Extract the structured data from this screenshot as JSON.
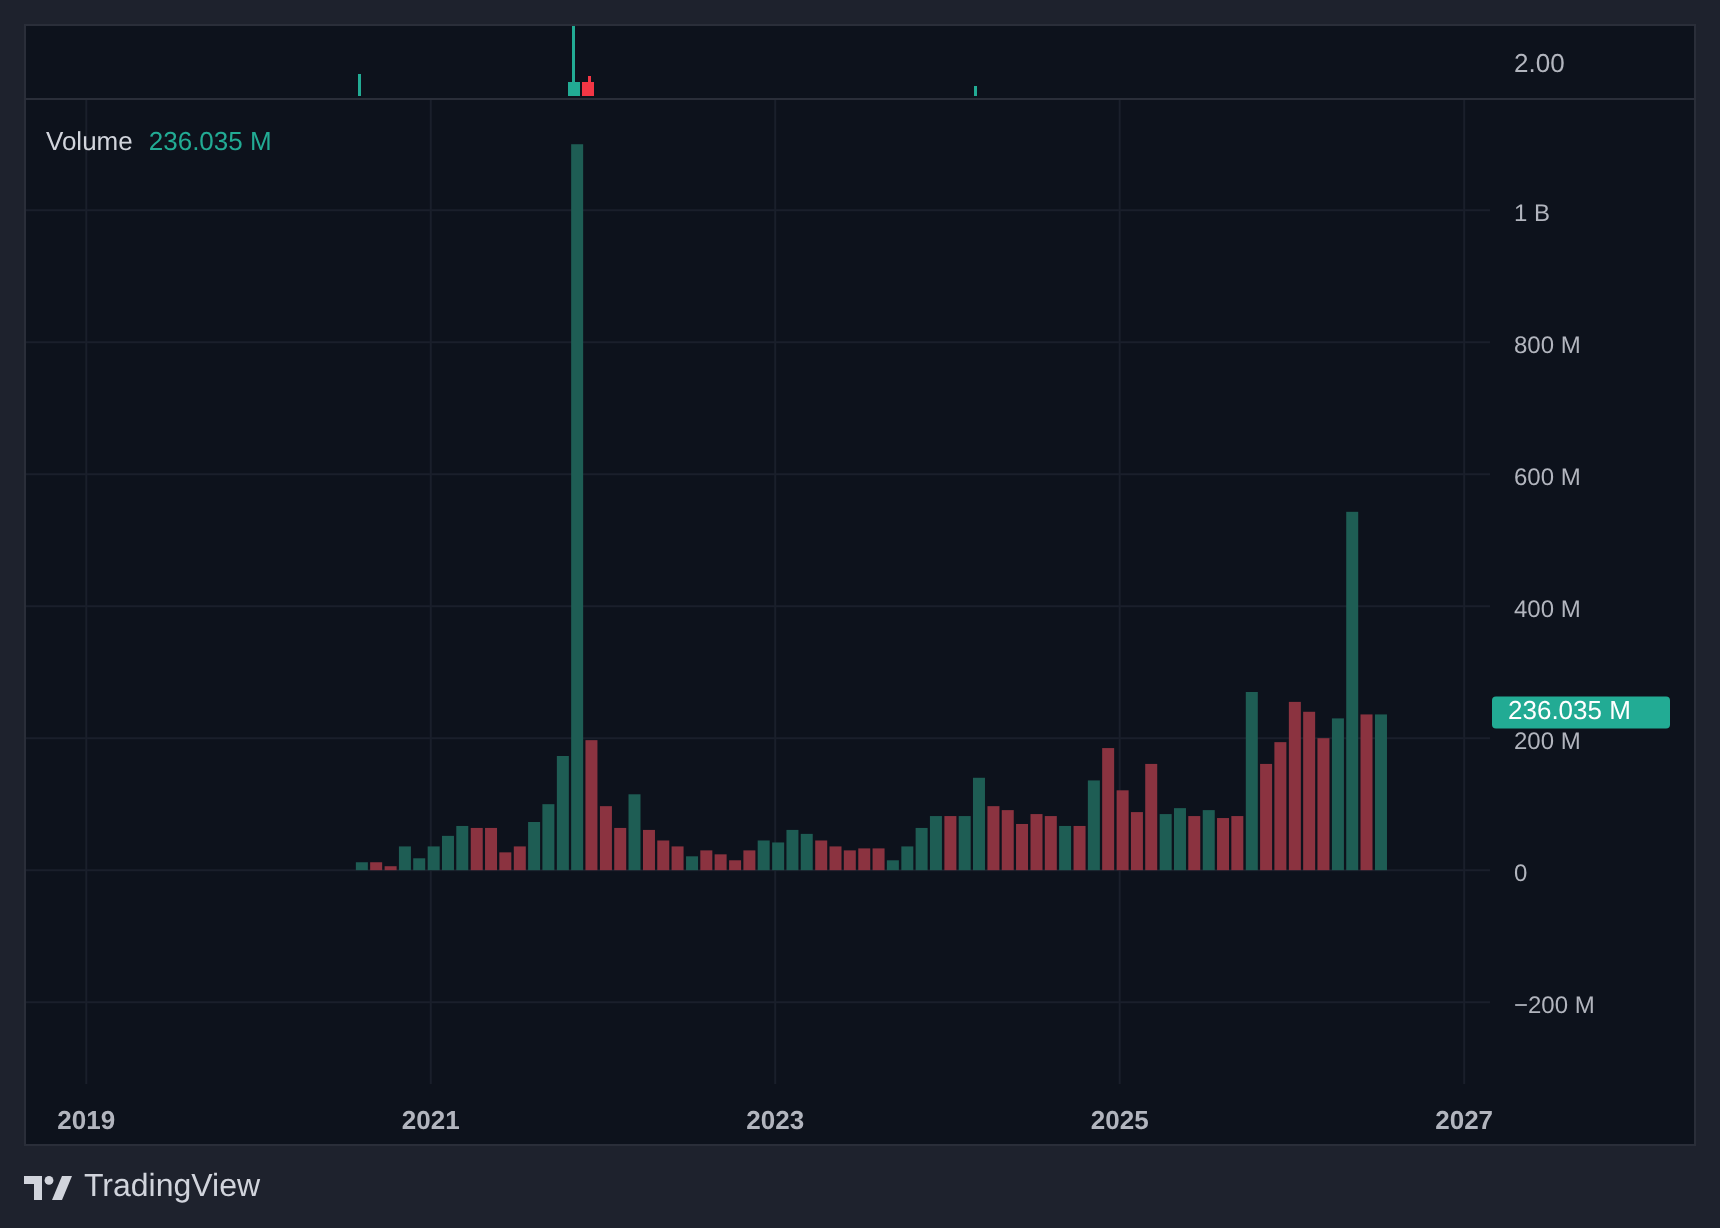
{
  "price_pane": {
    "scale_label": "2.00"
  },
  "legend": {
    "label": "Volume",
    "value": "236.035 M"
  },
  "last_value_badge": "236.035 M",
  "chart_data": {
    "type": "bar",
    "grid": true,
    "xlim": [
      2018.65,
      2027.15
    ],
    "ylim": [
      -324000000,
      1167000000
    ],
    "xticks": [
      {
        "value": 2019,
        "label": "2019"
      },
      {
        "value": 2021,
        "label": "2021"
      },
      {
        "value": 2023,
        "label": "2023"
      },
      {
        "value": 2025,
        "label": "2025"
      },
      {
        "value": 2027,
        "label": "2027"
      }
    ],
    "yticks": [
      {
        "value": -200000000,
        "label": "−200 M"
      },
      {
        "value": 0,
        "label": "0"
      },
      {
        "value": 200000000,
        "label": "200 M"
      },
      {
        "value": 400000000,
        "label": "400 M"
      },
      {
        "value": 600000000,
        "label": "600 M"
      },
      {
        "value": 800000000,
        "label": "800 M"
      },
      {
        "value": 1000000000,
        "label": "1 B"
      }
    ],
    "x": [
      2020.6,
      2020.683,
      2020.767,
      2020.85,
      2020.933,
      2021.017,
      2021.1,
      2021.183,
      2021.267,
      2021.35,
      2021.433,
      2021.517,
      2021.6,
      2021.683,
      2021.767,
      2021.85,
      2021.933,
      2022.017,
      2022.1,
      2022.183,
      2022.267,
      2022.35,
      2022.433,
      2022.517,
      2022.6,
      2022.683,
      2022.767,
      2022.85,
      2022.933,
      2023.017,
      2023.1,
      2023.183,
      2023.267,
      2023.35,
      2023.433,
      2023.517,
      2023.6,
      2023.683,
      2023.767,
      2023.85,
      2023.933,
      2024.017,
      2024.1,
      2024.183,
      2024.267,
      2024.35,
      2024.433,
      2024.517,
      2024.6,
      2024.683,
      2024.767,
      2024.85,
      2024.933,
      2025.017,
      2025.1,
      2025.183,
      2025.267,
      2025.35,
      2025.433,
      2025.517,
      2025.6,
      2025.683,
      2025.767,
      2025.85,
      2025.933,
      2026.017,
      2026.1,
      2026.183,
      2026.267,
      2026.35,
      2026.433,
      2026.517
    ],
    "series": [
      {
        "color": "#1e5d54",
        "values": [
          12000000.0,
          null,
          null,
          36000000.0,
          18000000.0,
          36000000.0,
          52000000.0,
          67000000.0,
          null,
          null,
          null,
          null,
          73000000.0,
          100000000.0,
          173000000.0,
          1100000000.0,
          null,
          null,
          null,
          115000000.0,
          null,
          null,
          null,
          21000000.0,
          null,
          null,
          null,
          null,
          45000000.0,
          42000000.0,
          61000000.0,
          55000000.0,
          null,
          null,
          null,
          null,
          null,
          15000000.0,
          36000000.0,
          64000000.0,
          82000000.0,
          null,
          82000000.0,
          140000000.0,
          null,
          null,
          null,
          null,
          null,
          67000000.0,
          null,
          136000000.0,
          null,
          null,
          null,
          null,
          85000000.0,
          94000000.0,
          null,
          91000000.0,
          null,
          null,
          270000000.0,
          null,
          null,
          null,
          null,
          null,
          230000000.0,
          543000000.0,
          null,
          236000000.0
        ]
      },
      {
        "color": "#8b3340",
        "values": [
          null,
          12000000.0,
          6000000.0,
          null,
          null,
          null,
          null,
          null,
          64000000.0,
          64000000.0,
          27000000.0,
          36000000.0,
          null,
          null,
          null,
          null,
          197000000.0,
          97000000.0,
          64000000.0,
          null,
          61000000.0,
          45000000.0,
          36000000.0,
          null,
          30000000.0,
          24000000.0,
          15000000.0,
          30000000.0,
          null,
          null,
          null,
          null,
          45000000.0,
          36000000.0,
          30000000.0,
          33000000.0,
          33000000.0,
          null,
          null,
          null,
          null,
          82000000.0,
          null,
          null,
          97000000.0,
          91000000.0,
          70000000.0,
          85000000.0,
          82000000.0,
          null,
          67000000.0,
          null,
          185000000.0,
          121000000.0,
          88000000.0,
          161000000.0,
          null,
          null,
          82000000.0,
          null,
          79000000.0,
          82000000.0,
          null,
          161000000.0,
          194000000.0,
          255000000.0,
          240000000.0,
          200000000.0,
          null,
          null,
          236000000.0,
          null
        ]
      }
    ]
  },
  "footer": {
    "brand": "TradingView"
  }
}
